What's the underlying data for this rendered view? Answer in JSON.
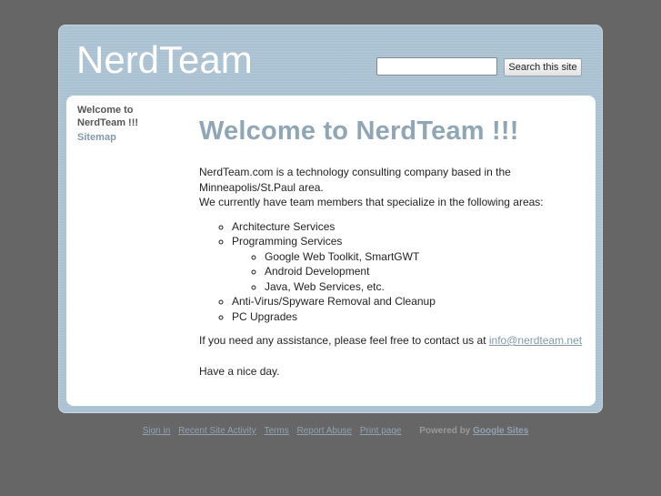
{
  "header": {
    "site_title": "NerdTeam",
    "search_button_label": "Search this site",
    "search_value": ""
  },
  "sidebar": {
    "current_page_line1": "Welcome to",
    "current_page_line2": "NerdTeam !!!",
    "sitemap_label": "Sitemap"
  },
  "main": {
    "heading": "Welcome to NerdTeam !!!",
    "intro_line1": "NerdTeam.com is a technology consulting company based in the",
    "intro_line2": "Minneapolis/St.Paul area.",
    "intro_line3": "We currently have team members that specialize in the following areas:",
    "services": [
      "Architecture Services",
      "Programming Services",
      "Anti-Virus/Spyware Removal and Cleanup",
      "PC Upgrades"
    ],
    "programming_sub": [
      "Google Web Toolkit, SmartGWT",
      "Android Development",
      "Java, Web Services, etc."
    ],
    "contact_text": "If you need any assistance, please feel free to contact us at ",
    "contact_email": "info@nerdteam.net",
    "closing": "Have a nice day."
  },
  "footer": {
    "links": [
      "Sign in",
      "Recent Site Activity",
      "Terms",
      "Report Abuse",
      "Print page"
    ],
    "powered_by": "Powered by",
    "powered_link": "Google Sites"
  },
  "colors": {
    "page_background": "#666666",
    "frame_background": "#a9c1d1",
    "heading": "#8ea6b6",
    "link": "#7f9aab"
  }
}
